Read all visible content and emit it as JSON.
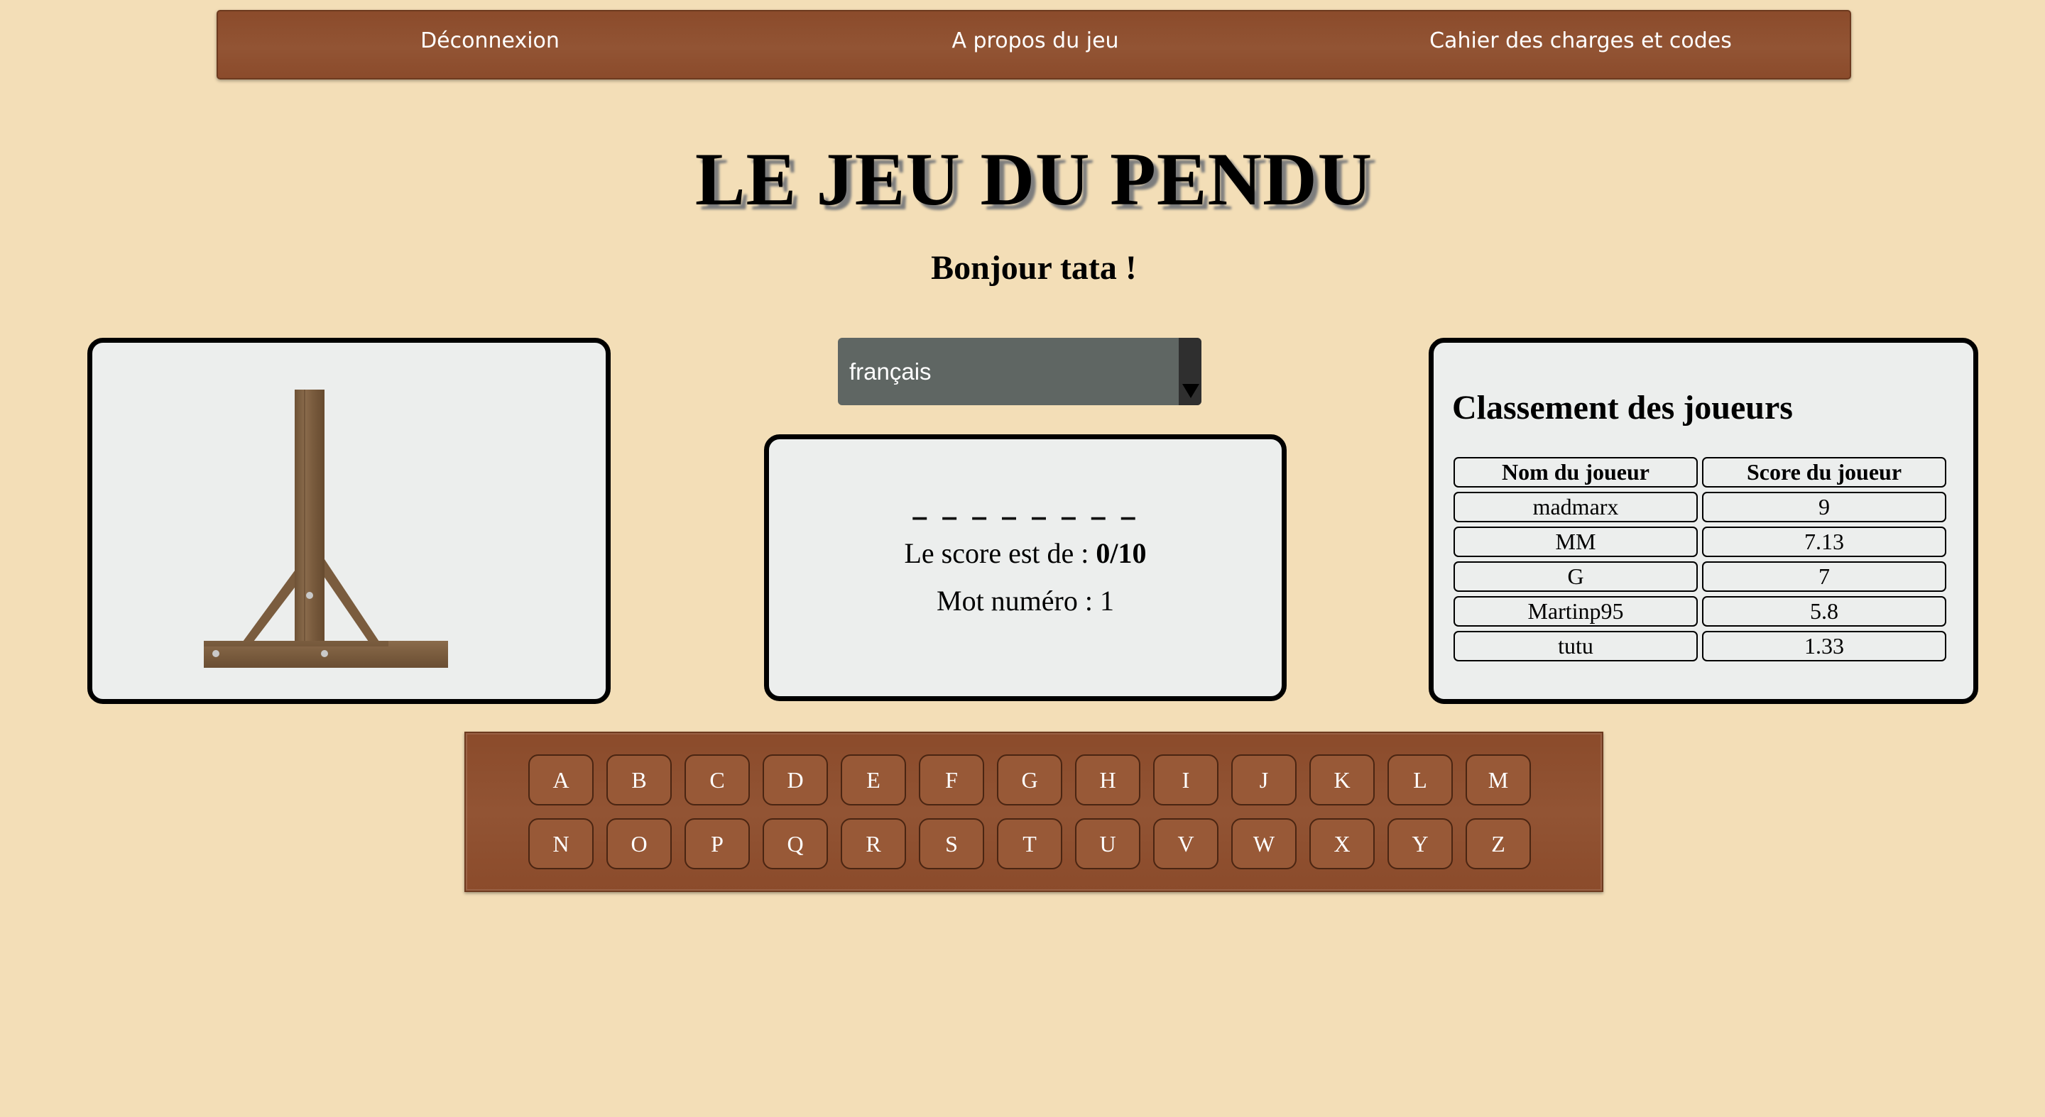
{
  "nav": {
    "logout": "Déconnexion",
    "about": "A propos du jeu",
    "specs": "Cahier des charges et codes"
  },
  "header": {
    "title": "LE JEU DU PENDU",
    "greeting": "Bonjour tata !"
  },
  "language_select": {
    "value": "français"
  },
  "game": {
    "masked_word": "_ _ _ _ _ _ _ _",
    "score_label": "Le score est de :",
    "score_value": "0/10",
    "word_number": "Mot numéro : 1"
  },
  "ranking": {
    "title": "Classement des joueurs",
    "headers": [
      "Nom du joueur",
      "Score du joueur"
    ],
    "rows": [
      [
        "madmarx",
        "9"
      ],
      [
        "MM",
        "7.13"
      ],
      [
        "G",
        "7"
      ],
      [
        "Martinp95",
        "5.8"
      ],
      [
        "tutu",
        "1.33"
      ]
    ]
  },
  "keyboard": {
    "row1": [
      "A",
      "B",
      "C",
      "D",
      "E",
      "F",
      "G",
      "H",
      "I",
      "J",
      "K",
      "L",
      "M"
    ],
    "row2": [
      "N",
      "O",
      "P",
      "Q",
      "R",
      "S",
      "T",
      "U",
      "V",
      "W",
      "X",
      "Y",
      "Z"
    ]
  },
  "colors": {
    "background": "#f3deb7",
    "wood_brown": "#8b4b2b",
    "panel_bg": "#eceeed",
    "select_bg": "#5f6663"
  },
  "icons": {
    "select_arrow": "triangle-down-icon",
    "gallows": "gallows-icon"
  }
}
